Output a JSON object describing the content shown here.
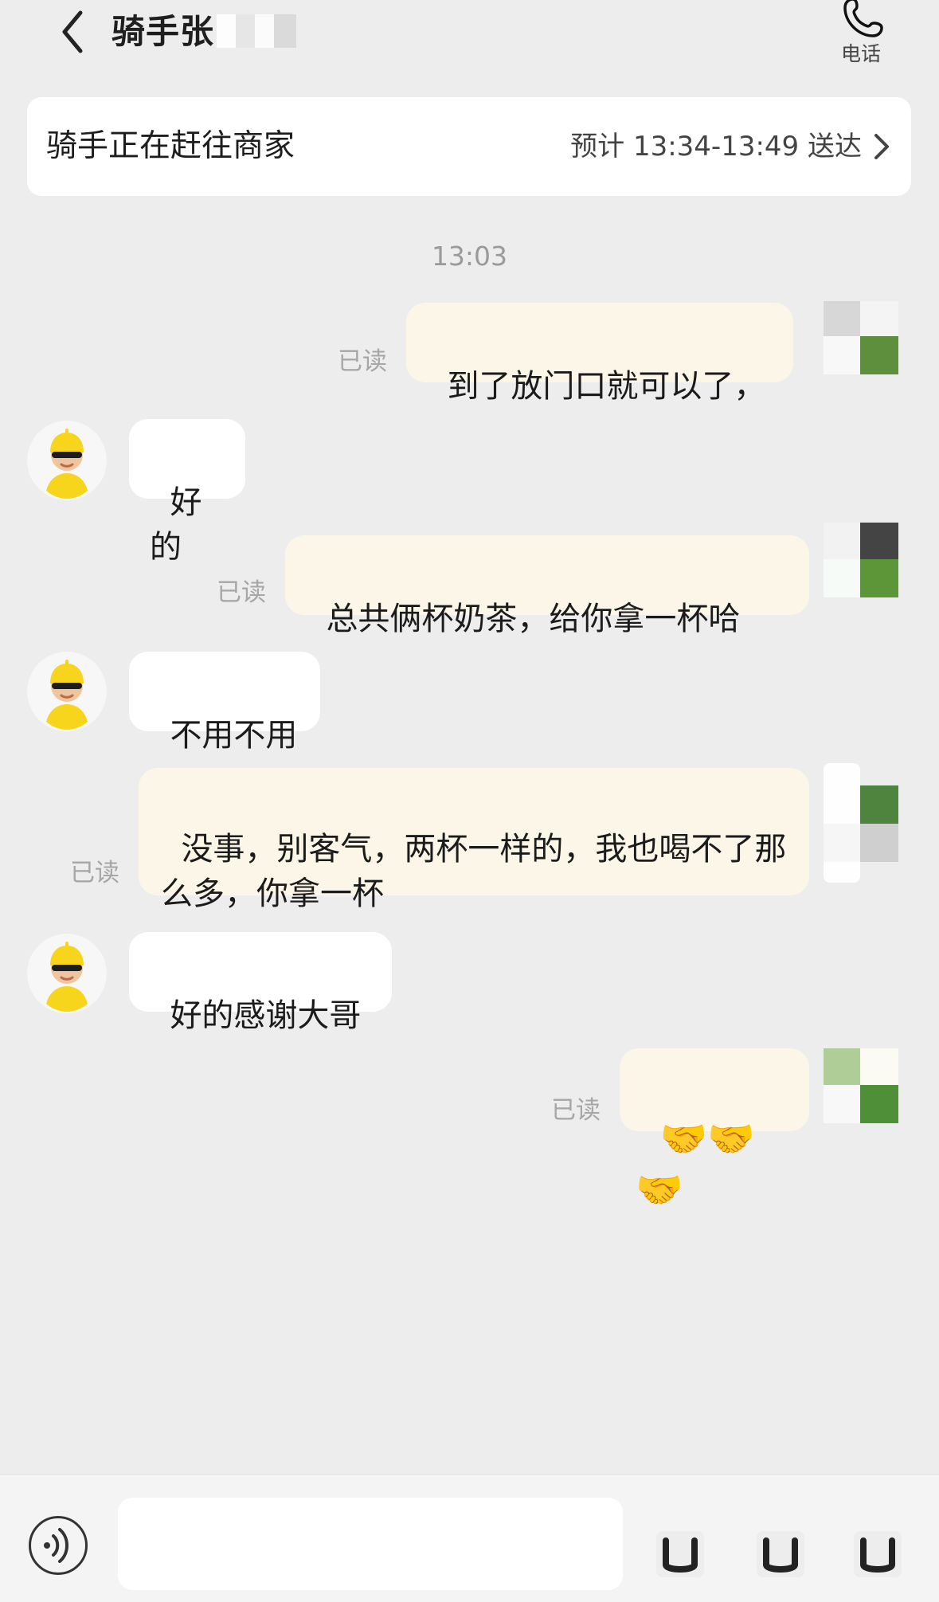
{
  "header": {
    "title": "骑手张",
    "phone_label": "电话"
  },
  "delivery_status": {
    "text": "骑手正在赶往商家",
    "eta": "预计 13:34-13:49 送达"
  },
  "chat": {
    "time": "13:03",
    "messages": [
      {
        "sender": "me",
        "text": "到了放门口就可以了，",
        "read_status": "已读"
      },
      {
        "sender": "rider",
        "text": "好的"
      },
      {
        "sender": "me",
        "text": "总共俩杯奶茶，给你拿一杯哈",
        "read_status": "已读"
      },
      {
        "sender": "rider",
        "text": "不用不用"
      },
      {
        "sender": "me",
        "text": "没事，别客气，两杯一样的，我也喝不了那么多，你拿一杯",
        "read_status": "已读"
      },
      {
        "sender": "rider",
        "text": "好的感谢大哥"
      },
      {
        "sender": "me",
        "text": "🤝🤝🤝",
        "read_status": "已读"
      }
    ]
  },
  "composer": {
    "input_value": "",
    "placeholder": "",
    "voice_icon": "voice-icon",
    "emoji_icon": "emoji-icon",
    "image_icon": "image-icon",
    "more_icon": "more-icon"
  },
  "colors": {
    "background": "#ededed",
    "outgoing_bubble": "#fbf6e7",
    "incoming_bubble": "#ffffff",
    "read_text": "#a6a6a6",
    "avatar_yellow": "#f7d51d"
  }
}
